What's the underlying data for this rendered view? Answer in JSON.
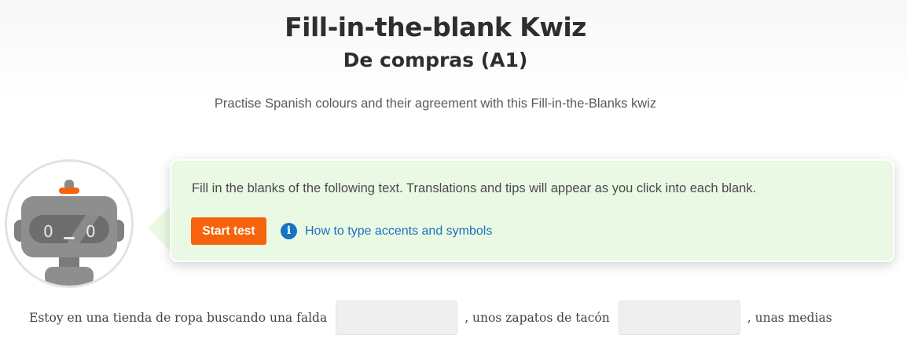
{
  "header": {
    "title": "Fill-in-the-blank Kwiz",
    "subtitle": "De compras (A1)",
    "description": "Practise Spanish colours and their agreement with this Fill-in-the-Blanks kwiz"
  },
  "instructions": {
    "text": "Fill in the blanks of the following text. Translations and tips will appear as you click into each blank.",
    "start_button_label": "Start test",
    "info_icon_glyph": "i",
    "accents_link_label": "How to type accents and symbols"
  },
  "exercise": {
    "segments": [
      "Estoy en una tienda de ropa buscando una falda",
      ",  unos zapatos de tacón",
      ",  unas medias"
    ],
    "blanks": [
      {
        "value": "",
        "placeholder": ""
      },
      {
        "value": "",
        "placeholder": ""
      }
    ]
  },
  "icons": {
    "avatar": "robot-avatar-icon",
    "info": "info-icon"
  },
  "colors": {
    "accent": "#f7630c",
    "link": "#1b6fc2",
    "info_box_bg": "#eaf9e3",
    "info_icon": "#1473c5"
  }
}
